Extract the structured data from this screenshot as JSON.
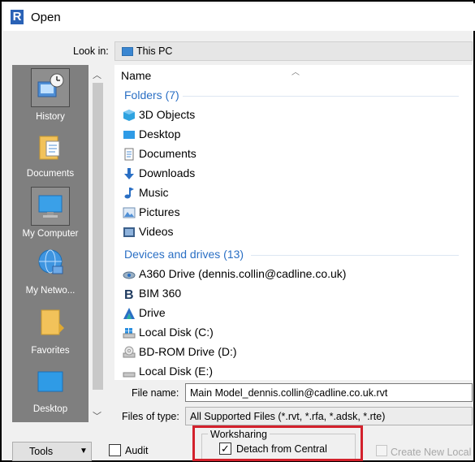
{
  "window": {
    "title": "Open",
    "app_icon_letter": "R"
  },
  "look_in": {
    "label": "Look in:",
    "value": "This PC"
  },
  "places": [
    {
      "label": "History",
      "icon": "history-icon"
    },
    {
      "label": "Documents",
      "icon": "documents-folder-icon"
    },
    {
      "label": "My Computer",
      "icon": "computer-monitor-icon",
      "selected": true
    },
    {
      "label": "My Netwo...",
      "icon": "network-globe-icon"
    },
    {
      "label": "Favorites",
      "icon": "favorites-folder-icon"
    },
    {
      "label": "Desktop",
      "icon": "desktop-icon"
    }
  ],
  "file_list": {
    "column_name": "Name",
    "folders_group": "Folders (7)",
    "folders": [
      "3D Objects",
      "Desktop",
      "Documents",
      "Downloads",
      "Music",
      "Pictures",
      "Videos"
    ],
    "drives_group": "Devices and drives (13)",
    "drives": [
      "A360 Drive (dennis.collin@cadline.co.uk)",
      "BIM 360",
      "Drive",
      "Local Disk (C:)",
      "BD-ROM Drive (D:)",
      "Local Disk (E:)"
    ]
  },
  "file_name": {
    "label": "File name:",
    "value": "Main Model_dennis.collin@cadline.co.uk.rvt"
  },
  "file_type": {
    "label": "Files of type:",
    "value": "All Supported Files  (*.rvt, *.rfa, *.adsk, *.rte)"
  },
  "tools": {
    "label": "Tools"
  },
  "audit": {
    "label": "Audit",
    "checked": false
  },
  "worksharing": {
    "group_label": "Worksharing",
    "detach_label": "Detach from Central",
    "detach_checked": true,
    "check_mark": "✓",
    "create_new_local_label": "Create New Local",
    "create_new_local_enabled": false
  },
  "colors": {
    "accent_blue": "#2a6fc4",
    "highlight_red": "#d3212c",
    "places_bg": "#7f7f7f"
  }
}
